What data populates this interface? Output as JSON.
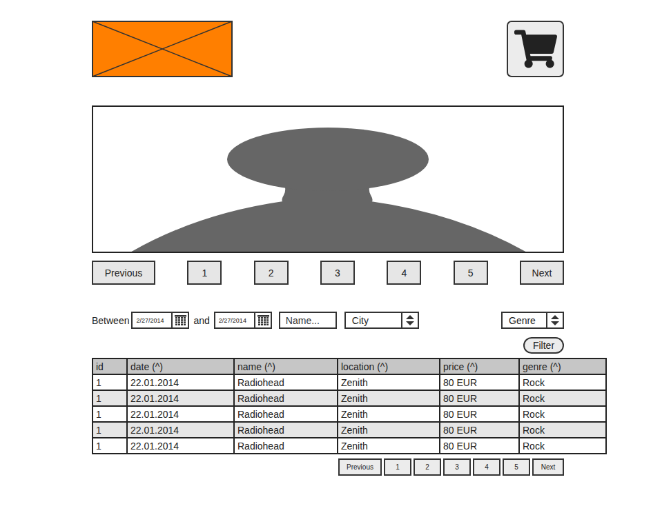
{
  "carousel_pager": [
    "Previous",
    "1",
    "2",
    "3",
    "4",
    "5",
    "Next"
  ],
  "filters": {
    "between_label": "Between",
    "date_from": "2/27/2014",
    "and_label": "and",
    "date_to": "2/27/2014",
    "name_placeholder": "Name...",
    "city": "City",
    "genre": "Genre",
    "filter_button": "Filter"
  },
  "table": {
    "columns": [
      "id",
      "date (^)",
      "name (^)",
      "location (^)",
      "price (^)",
      "genre (^)"
    ],
    "rows": [
      [
        "1",
        "22.01.2014",
        "Radiohead",
        "Zenith",
        "80 EUR",
        "Rock"
      ],
      [
        "1",
        "22.01.2014",
        "Radiohead",
        "Zenith",
        "80 EUR",
        "Rock"
      ],
      [
        "1",
        "22.01.2014",
        "Radiohead",
        "Zenith",
        "80 EUR",
        "Rock"
      ],
      [
        "1",
        "22.01.2014",
        "Radiohead",
        "Zenith",
        "80 EUR",
        "Rock"
      ],
      [
        "1",
        "22.01.2014",
        "Radiohead",
        "Zenith",
        "80 EUR",
        "Rock"
      ]
    ]
  },
  "table_pager": [
    "Previous",
    "1",
    "2",
    "3",
    "4",
    "5",
    "Next"
  ]
}
